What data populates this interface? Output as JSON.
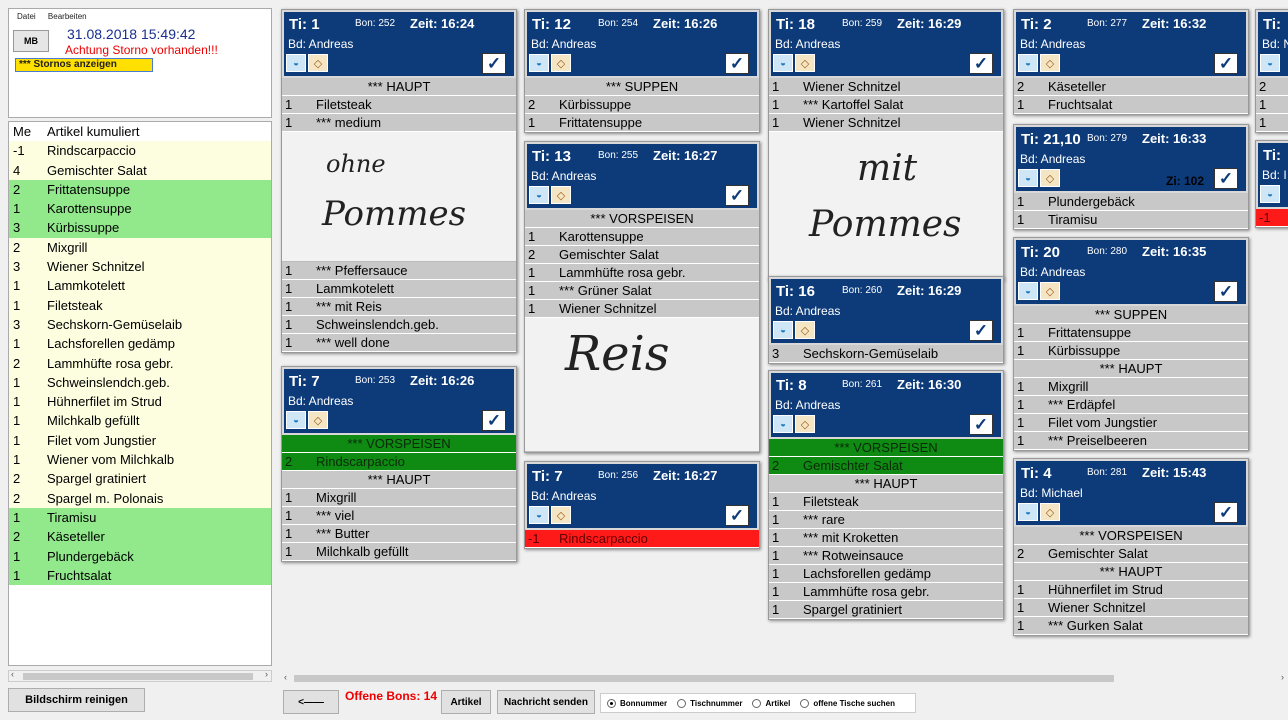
{
  "menu": [
    "Datei",
    "Bearbeiten"
  ],
  "user_initials": "MB",
  "datetime": "31.08.2018 15:49:42",
  "storno_warning": "Achtung Storno vorhanden!!!",
  "show_storno": "*** Stornos anzeigen",
  "list_header": {
    "qty": "Me",
    "name": "Artikel kumuliert"
  },
  "list_items": [
    {
      "qty": "-1",
      "name": "Rindscarpaccio",
      "bg": "y"
    },
    {
      "qty": "4",
      "name": "Gemischter Salat",
      "bg": "y"
    },
    {
      "qty": "2",
      "name": "Frittatensuppe",
      "bg": "g"
    },
    {
      "qty": "1",
      "name": "Karottensuppe",
      "bg": "g"
    },
    {
      "qty": "3",
      "name": "Kürbissuppe",
      "bg": "g"
    },
    {
      "qty": "2",
      "name": "Mixgrill",
      "bg": "y"
    },
    {
      "qty": "3",
      "name": "Wiener Schnitzel",
      "bg": "y"
    },
    {
      "qty": "1",
      "name": "Lammkotelett",
      "bg": "y"
    },
    {
      "qty": "1",
      "name": "Filetsteak",
      "bg": "y"
    },
    {
      "qty": "3",
      "name": "Sechskorn-Gemüselaib",
      "bg": "y"
    },
    {
      "qty": "1",
      "name": "Lachsforellen gedämp",
      "bg": "y"
    },
    {
      "qty": "2",
      "name": "Lammhüfte rosa gebr.",
      "bg": "y"
    },
    {
      "qty": "1",
      "name": "Schweinslendch.geb.",
      "bg": "y"
    },
    {
      "qty": "1",
      "name": "Hühnerfilet im Strud",
      "bg": "y"
    },
    {
      "qty": "1",
      "name": "Milchkalb gefüllt",
      "bg": "y"
    },
    {
      "qty": "1",
      "name": "Filet vom Jungstier",
      "bg": "y"
    },
    {
      "qty": "1",
      "name": "Wiener vom Milchkalb",
      "bg": "y"
    },
    {
      "qty": "2",
      "name": "Spargel gratiniert",
      "bg": "y"
    },
    {
      "qty": "2",
      "name": "Spargel m. Polonais",
      "bg": "y"
    },
    {
      "qty": "1",
      "name": "Tiramisu",
      "bg": "g"
    },
    {
      "qty": "2",
      "name": "Käseteller",
      "bg": "g"
    },
    {
      "qty": "1",
      "name": "Plundergebäck",
      "bg": "g"
    },
    {
      "qty": "1",
      "name": "Fruchtsalat",
      "bg": "g"
    }
  ],
  "cards": {
    "c1": {
      "ti": "Ti: 1",
      "bon": "Bon: 252",
      "zeit": "Zeit: 16:24",
      "bd": "Bd: Andreas",
      "rows": [
        {
          "t": "hdr",
          "n": "*** HAUPT"
        },
        {
          "q": "1",
          "n": "Filetsteak"
        },
        {
          "q": "1",
          "n": "*** medium"
        }
      ],
      "note": "ohne Pommes",
      "rows2": [
        {
          "q": "1",
          "n": "*** Pfeffersauce"
        },
        {
          "q": "1",
          "n": "Lammkotelett"
        },
        {
          "q": "1",
          "n": "*** mit Reis"
        },
        {
          "q": "1",
          "n": "Schweinslendch.geb."
        },
        {
          "q": "1",
          "n": "*** well done"
        }
      ]
    },
    "c2": {
      "ti": "Ti: 7",
      "bon": "Bon: 253",
      "zeit": "Zeit: 16:26",
      "bd": "Bd: Andreas",
      "rows": [
        {
          "t": "gr",
          "n": "*** VORSPEISEN",
          "hdr": true
        },
        {
          "t": "gr",
          "q": "2",
          "n": "Rindscarpaccio"
        },
        {
          "t": "hdr",
          "n": "*** HAUPT"
        },
        {
          "q": "1",
          "n": "Mixgrill"
        },
        {
          "q": "1",
          "n": "*** viel"
        },
        {
          "q": "1",
          "n": "*** Butter"
        },
        {
          "q": "1",
          "n": "Milchkalb gefüllt"
        }
      ]
    },
    "c3": {
      "ti": "Ti: 12",
      "bon": "Bon: 254",
      "zeit": "Zeit: 16:26",
      "bd": "Bd: Andreas",
      "rows": [
        {
          "t": "hdr",
          "n": "*** SUPPEN"
        },
        {
          "q": "2",
          "n": "Kürbissuppe"
        },
        {
          "q": "1",
          "n": "Frittatensuppe"
        }
      ]
    },
    "c4": {
      "ti": "Ti: 13",
      "bon": "Bon: 255",
      "zeit": "Zeit: 16:27",
      "bd": "Bd: Andreas",
      "rows": [
        {
          "t": "hdr",
          "n": "*** VORSPEISEN"
        },
        {
          "q": "1",
          "n": "Karottensuppe"
        },
        {
          "q": "2",
          "n": "Gemischter Salat"
        },
        {
          "q": "1",
          "n": "Lammhüfte rosa gebr."
        },
        {
          "q": "1",
          "n": "*** Grüner Salat"
        },
        {
          "q": "1",
          "n": "Wiener Schnitzel"
        }
      ],
      "note": "Reis"
    },
    "c5": {
      "ti": "Ti: 7",
      "bon": "Bon: 256",
      "zeit": "Zeit: 16:27",
      "bd": "Bd: Andreas",
      "rows": [
        {
          "t": "red",
          "q": "-1",
          "n": "Rindscarpaccio"
        }
      ]
    },
    "c6": {
      "ti": "Ti: 18",
      "bon": "Bon: 259",
      "zeit": "Zeit: 16:29",
      "bd": "Bd: Andreas",
      "rows": [
        {
          "q": "1",
          "n": "Wiener Schnitzel"
        },
        {
          "q": "1",
          "n": "*** Kartoffel Salat"
        },
        {
          "q": "1",
          "n": "Wiener Schnitzel"
        }
      ],
      "note": "mit Pommes"
    },
    "c7": {
      "ti": "Ti: 16",
      "bon": "Bon: 260",
      "zeit": "Zeit: 16:29",
      "bd": "Bd: Andreas",
      "rows": [
        {
          "q": "3",
          "n": "Sechskorn-Gemüselaib"
        }
      ]
    },
    "c8": {
      "ti": "Ti: 8",
      "bon": "Bon: 261",
      "zeit": "Zeit: 16:30",
      "bd": "Bd: Andreas",
      "rows": [
        {
          "t": "gr",
          "n": "*** VORSPEISEN",
          "hdr": true
        },
        {
          "t": "gr",
          "q": "2",
          "n": "Gemischter Salat"
        },
        {
          "t": "hdr",
          "n": "*** HAUPT"
        },
        {
          "q": "1",
          "n": "Filetsteak"
        },
        {
          "q": "1",
          "n": "*** rare"
        },
        {
          "q": "1",
          "n": "*** mit Kroketten"
        },
        {
          "q": "1",
          "n": "*** Rotweinsauce"
        },
        {
          "q": "1",
          "n": "Lachsforellen gedämp"
        },
        {
          "q": "1",
          "n": "Lammhüfte rosa gebr."
        },
        {
          "q": "1",
          "n": "Spargel gratiniert"
        }
      ]
    },
    "c9": {
      "ti": "Ti: 2",
      "bon": "Bon: 277",
      "zeit": "Zeit: 16:32",
      "bd": "Bd: Andreas",
      "rows": [
        {
          "q": "2",
          "n": "Käseteller"
        },
        {
          "q": "1",
          "n": "Fruchtsalat"
        }
      ]
    },
    "c10": {
      "ti": "Ti: 21,10",
      "bon": "Bon: 279",
      "zeit": "Zeit: 16:33",
      "bd": "Bd: Andreas",
      "zi": "Zi: 102",
      "rows": [
        {
          "q": "1",
          "n": "Plundergebäck"
        },
        {
          "q": "1",
          "n": "Tiramisu"
        }
      ]
    },
    "c11": {
      "ti": "Ti: 20",
      "bon": "Bon: 280",
      "zeit": "Zeit: 16:35",
      "bd": "Bd: Andreas",
      "rows": [
        {
          "t": "hdr",
          "n": "*** SUPPEN"
        },
        {
          "q": "1",
          "n": "Frittatensuppe"
        },
        {
          "q": "1",
          "n": "Kürbissuppe"
        },
        {
          "t": "hdr",
          "n": "*** HAUPT"
        },
        {
          "q": "1",
          "n": "Mixgrill"
        },
        {
          "q": "1",
          "n": "*** Erdäpfel"
        },
        {
          "q": "1",
          "n": "Filet vom Jungstier"
        },
        {
          "q": "1",
          "n": "*** Preiselbeeren"
        }
      ]
    },
    "c12": {
      "ti": "Ti: 4",
      "bon": "Bon: 281",
      "zeit": "Zeit: 15:43",
      "bd": "Bd: Michael",
      "rows": [
        {
          "t": "hdr",
          "n": "*** VORSPEISEN"
        },
        {
          "q": "2",
          "n": "Gemischter Salat"
        },
        {
          "t": "hdr",
          "n": "*** HAUPT"
        },
        {
          "q": "1",
          "n": "Hühnerfilet im Strud"
        },
        {
          "q": "1",
          "n": "Wiener Schnitzel"
        },
        {
          "q": "1",
          "n": "*** Gurken Salat"
        }
      ]
    },
    "c13": {
      "ti": "Ti:",
      "bd": "Bd: N",
      "rows": [
        {
          "q": "2",
          "n": ""
        },
        {
          "q": "1",
          "n": ""
        },
        {
          "q": "1",
          "n": ""
        }
      ]
    },
    "c14": {
      "ti": "Ti:",
      "bd": "Bd: I",
      "rows": [
        {
          "t": "red",
          "q": "-1",
          "n": ""
        }
      ]
    }
  },
  "bottom": {
    "clear_button": "Bildschirm reinigen",
    "back_button": "<——",
    "offene_bons": "Offene Bons: 14",
    "artikel_button": "Artikel",
    "message_button": "Nachricht senden",
    "radio_options": [
      "Bonnummer",
      "Tischnummer",
      "Artikel",
      "offene Tische suchen"
    ],
    "radio_selected": "Bonnummer"
  }
}
